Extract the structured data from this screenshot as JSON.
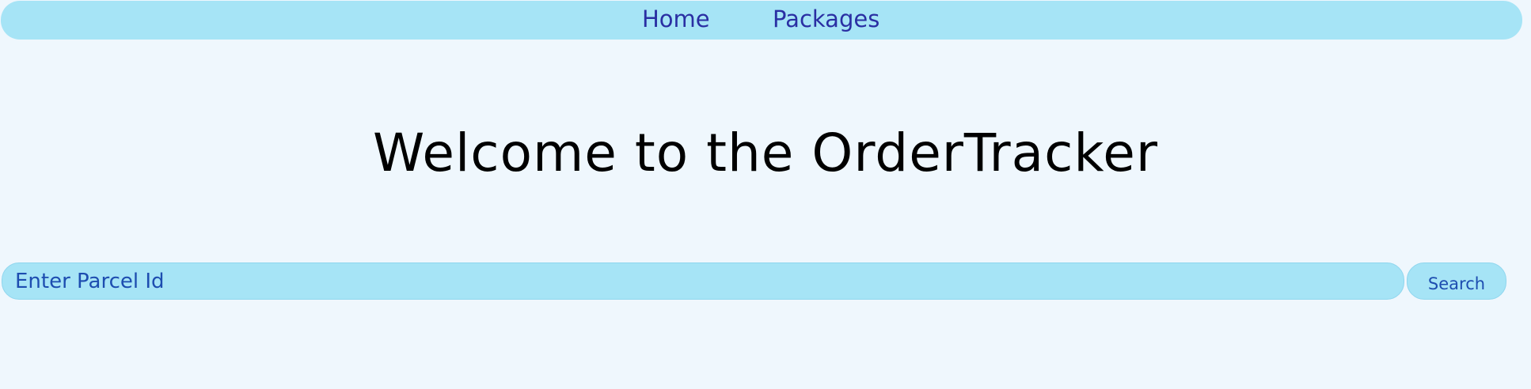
{
  "nav": {
    "home_label": "Home",
    "packages_label": "Packages"
  },
  "main": {
    "title": "Welcome to the OrderTracker"
  },
  "search": {
    "placeholder": "Enter Parcel Id",
    "button_label": "Search"
  },
  "colors": {
    "background": "#eff7fd",
    "accent": "#a6e4f6",
    "nav_text": "#2a2fa3",
    "input_text": "#1d4db0"
  }
}
